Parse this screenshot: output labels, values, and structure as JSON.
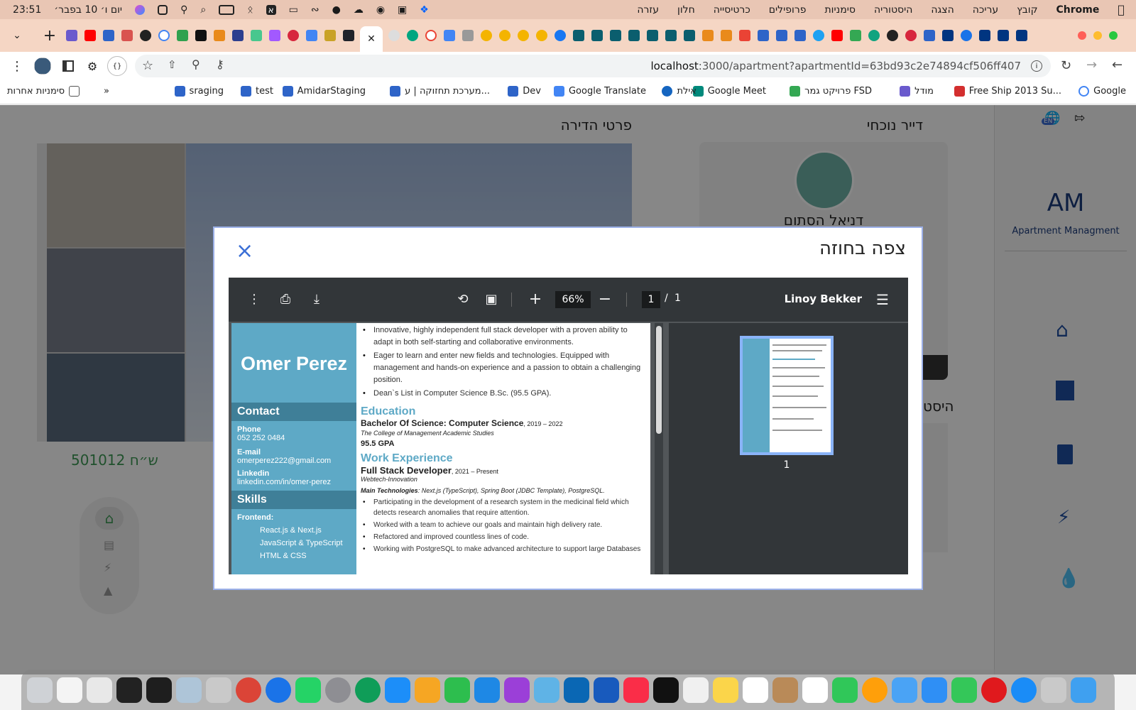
{
  "menubar": {
    "apple": "",
    "app": "Chrome",
    "menus": [
      "קובץ",
      "עריכה",
      "הצגה",
      "היסטוריה",
      "סימניות",
      "פרופילים",
      "כרטיסייה",
      "חלון",
      "עזרה"
    ],
    "clock": "23:51",
    "date": "יום ו׳ 10 בפבר׳",
    "input_source": "א"
  },
  "tabs": {
    "new_tab": "+",
    "close_active": "✕"
  },
  "toolbar": {
    "url_host": "localhost",
    "url_rest": ":3000/apartment?apartmentId=63bd93c2e74894cf506ff407"
  },
  "bookmarks": {
    "items": [
      "Google",
      "Free Ship 2013 Su...",
      "מודל",
      "פרויקט גמר FSD",
      "Google Meet",
      "אילת",
      "Google Translate",
      "Dev",
      "מערכת תחזוקה | ע...",
      "AmidarStaging",
      "test",
      "sraging"
    ],
    "overflow": "»",
    "other": "סימניות אחרות"
  },
  "page": {
    "apartment_details": "פרטי הדירה",
    "current_tenant": "דייר נוכחי",
    "tenant_name": "דניאל הסתום",
    "price": "501012 ש״ח",
    "history": "היסט",
    "app_short": "AM",
    "app_name": "Apartment Managment",
    "lang": "EN"
  },
  "modal": {
    "title": "צפה בחוזה",
    "close": "×"
  },
  "pdf_viewer": {
    "document_title": "Linoy Bekker",
    "zoom": "66%",
    "page_current": "1",
    "page_sep": "/",
    "page_total": "1",
    "thumb_label": "1"
  },
  "resume": {
    "name": "Omer Perez",
    "contact_heading": "Contact",
    "phone_label": "Phone",
    "phone": "052 252 0484",
    "email_label": "E-mail",
    "email": "omerperez222@gmail.com",
    "linkedin_label": "Linkedin",
    "linkedin": "linkedin.com/in/omer-perez",
    "skills_heading": "Skills",
    "frontend_label": "Frontend:",
    "frontend": [
      "React.js & Next.js",
      "JavaScript & TypeScript",
      "HTML & CSS"
    ],
    "summary": [
      "Innovative, highly independent full stack developer with a proven ability to adapt in both self-starting and collaborative environments.",
      "Eager to learn and enter new fields and technologies. Equipped with management and hands-on experience and a passion to obtain a challenging position.",
      "Dean`s List in Computer Science B.Sc. (95.5 GPA)."
    ],
    "education_heading": "Education",
    "degree": "Bachelor Of Science: Computer Science",
    "degree_years": ", 2019 – 2022",
    "college": "The College of Management Academic Studies",
    "gpa": "95.5 GPA",
    "work_heading": "Work Experience",
    "job_title": "Full Stack Developer",
    "job_years": ", 2021 – Present",
    "company": "Webtech-Innovation",
    "tech_label": "Main Technologies",
    "tech": ": Next.js (TypeScript), Spring Boot (JDBC Template), PostgreSQL.",
    "duties": [
      "Participating in the development of a research system in the medicinal field which detects research anomalies that require attention.",
      "Worked with a team to achieve our goals and maintain high delivery rate.",
      "Refactored and improved countless lines of code.",
      "Working with PostgreSQL to make advanced architecture to support large Databases"
    ]
  },
  "colors": {
    "accent": "#5ea9c6",
    "nav_icons": "#1f4fa0",
    "price_green": "#3e9a55",
    "modal_border": "#9cb0e8"
  }
}
